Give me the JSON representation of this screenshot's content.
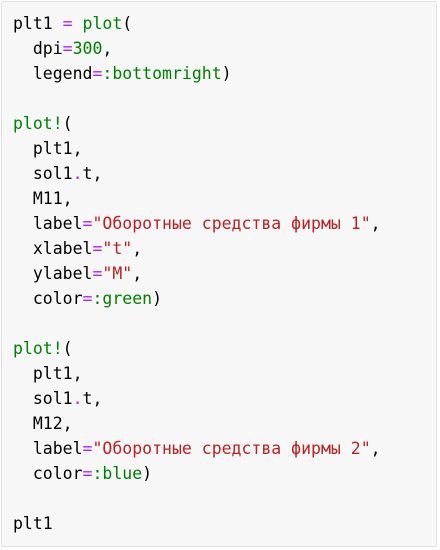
{
  "code_lines": [
    [
      {
        "t": "plt1 ",
        "c": "plain"
      },
      {
        "t": "=",
        "c": "op"
      },
      {
        "t": " ",
        "c": "plain"
      },
      {
        "t": "plot",
        "c": "fn"
      },
      {
        "t": "(",
        "c": "plain"
      }
    ],
    [
      {
        "t": "  dpi",
        "c": "plain"
      },
      {
        "t": "=",
        "c": "op"
      },
      {
        "t": "300",
        "c": "num"
      },
      {
        "t": ",",
        "c": "plain"
      }
    ],
    [
      {
        "t": "  legend",
        "c": "plain"
      },
      {
        "t": "=",
        "c": "op"
      },
      {
        "t": ":bottomright",
        "c": "sym"
      },
      {
        "t": ")",
        "c": "plain"
      }
    ],
    [],
    [
      {
        "t": "plot!",
        "c": "fn"
      },
      {
        "t": "(",
        "c": "plain"
      }
    ],
    [
      {
        "t": "  plt1,",
        "c": "plain"
      }
    ],
    [
      {
        "t": "  sol1",
        "c": "plain"
      },
      {
        "t": ".",
        "c": "op"
      },
      {
        "t": "t,",
        "c": "plain"
      }
    ],
    [
      {
        "t": "  M11,",
        "c": "plain"
      }
    ],
    [
      {
        "t": "  label",
        "c": "plain"
      },
      {
        "t": "=",
        "c": "op"
      },
      {
        "t": "\"Оборотные средства фирмы 1\"",
        "c": "str"
      },
      {
        "t": ",",
        "c": "plain"
      }
    ],
    [
      {
        "t": "  xlabel",
        "c": "plain"
      },
      {
        "t": "=",
        "c": "op"
      },
      {
        "t": "\"t\"",
        "c": "str"
      },
      {
        "t": ",",
        "c": "plain"
      }
    ],
    [
      {
        "t": "  ylabel",
        "c": "plain"
      },
      {
        "t": "=",
        "c": "op"
      },
      {
        "t": "\"M\"",
        "c": "str"
      },
      {
        "t": ",",
        "c": "plain"
      }
    ],
    [
      {
        "t": "  color",
        "c": "plain"
      },
      {
        "t": "=",
        "c": "op"
      },
      {
        "t": ":green",
        "c": "sym"
      },
      {
        "t": ")",
        "c": "plain"
      }
    ],
    [],
    [
      {
        "t": "plot!",
        "c": "fn"
      },
      {
        "t": "(",
        "c": "plain"
      }
    ],
    [
      {
        "t": "  plt1,",
        "c": "plain"
      }
    ],
    [
      {
        "t": "  sol1",
        "c": "plain"
      },
      {
        "t": ".",
        "c": "op"
      },
      {
        "t": "t,",
        "c": "plain"
      }
    ],
    [
      {
        "t": "  M12,",
        "c": "plain"
      }
    ],
    [
      {
        "t": "  label",
        "c": "plain"
      },
      {
        "t": "=",
        "c": "op"
      },
      {
        "t": "\"Оборотные средства фирмы 2\"",
        "c": "str"
      },
      {
        "t": ",",
        "c": "plain"
      }
    ],
    [
      {
        "t": "  color",
        "c": "plain"
      },
      {
        "t": "=",
        "c": "op"
      },
      {
        "t": ":blue",
        "c": "sym"
      },
      {
        "t": ")",
        "c": "plain"
      }
    ],
    [],
    [
      {
        "t": "plt1",
        "c": "plain"
      }
    ]
  ],
  "colors": {
    "background": "#f7f7f7",
    "border": "#e0e0e0",
    "plain": "#000000",
    "fn": "#008000",
    "num": "#008000",
    "op": "#aa22ff",
    "sym": "#008000",
    "str": "#ba2121"
  }
}
